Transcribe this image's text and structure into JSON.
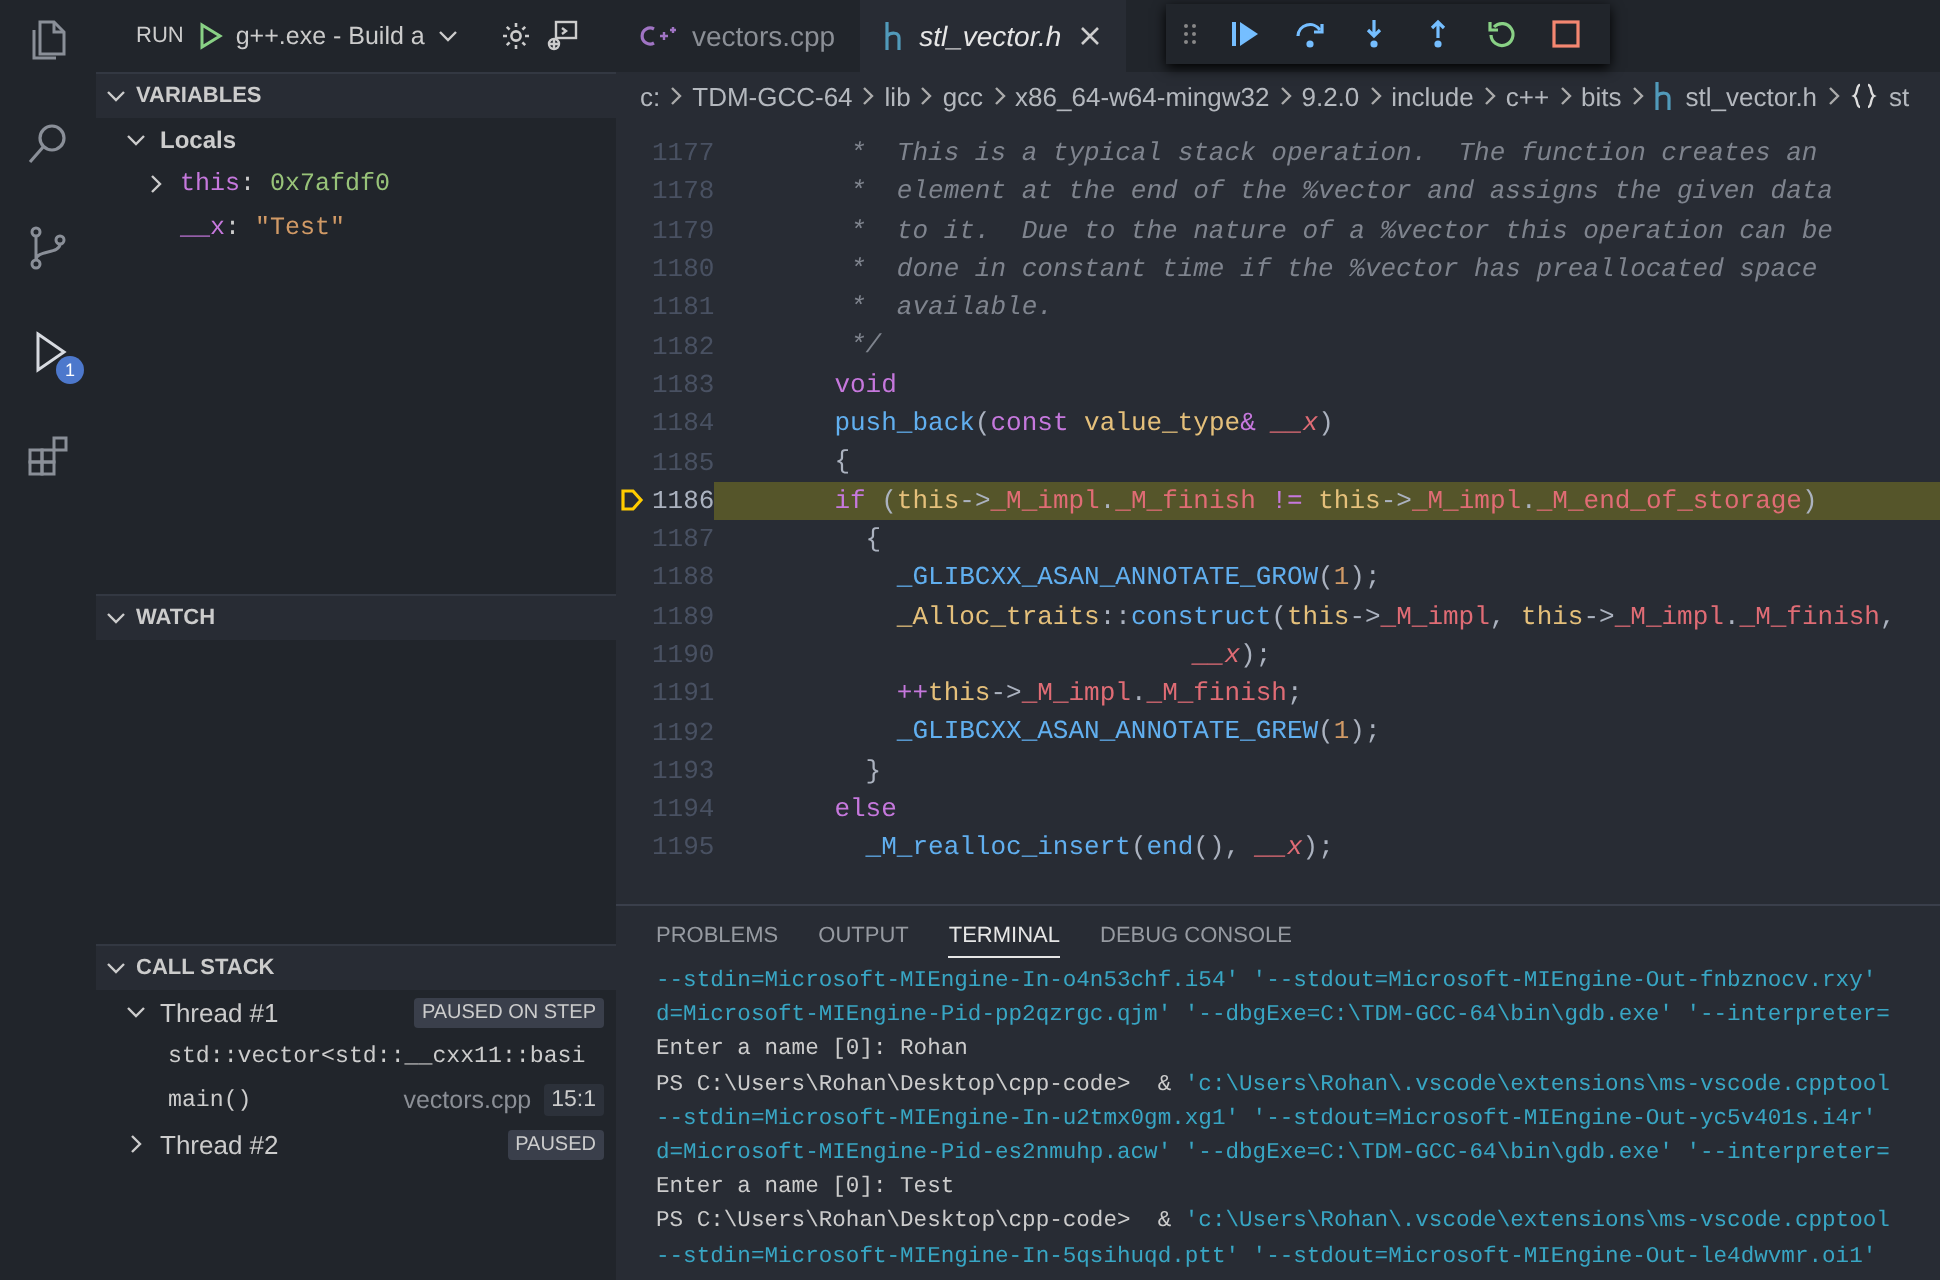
{
  "activity_bar": {
    "items": [
      {
        "kind": "files",
        "selected": false
      },
      {
        "kind": "search",
        "selected": false
      },
      {
        "kind": "source-control",
        "selected": false
      },
      {
        "kind": "debug",
        "selected": true,
        "badge": "1"
      },
      {
        "kind": "extensions",
        "selected": false
      }
    ]
  },
  "run_toolbar": {
    "label": "RUN",
    "configuration": "g++.exe - Build a"
  },
  "sidebar": {
    "variables": {
      "title": "VARIABLES",
      "scopes": [
        {
          "label": "Locals",
          "expanded": true,
          "children": [
            {
              "name": "this",
              "separator": ":",
              "value": "0x7afdf0",
              "expanded": false,
              "kind": "pointer"
            },
            {
              "name": "__x",
              "separator": ":",
              "value": "\"Test\"",
              "kind": "string"
            }
          ]
        }
      ]
    },
    "watch": {
      "title": "WATCH"
    },
    "call_stack": {
      "title": "CALL STACK",
      "threads": [
        {
          "label": "Thread #1",
          "expanded": true,
          "status": "PAUSED ON STEP",
          "frames": [
            {
              "name": "std::vector<std::__cxx11::basi"
            },
            {
              "name": "main()",
              "file": "vectors.cpp",
              "position": "15:1"
            }
          ]
        },
        {
          "label": "Thread #2",
          "expanded": false,
          "status": "PAUSED"
        }
      ]
    }
  },
  "tabs": [
    {
      "label": "vectors.cpp",
      "kind": "cpp",
      "selected": false
    },
    {
      "label": "stl_vector.h",
      "kind": "header",
      "selected": true
    }
  ],
  "debug_toolbar": [
    {
      "kind": "continue"
    },
    {
      "kind": "step-over"
    },
    {
      "kind": "step-into"
    },
    {
      "kind": "step-out"
    },
    {
      "kind": "restart"
    },
    {
      "kind": "stop"
    }
  ],
  "breadcrumb": [
    {
      "label": "c:"
    },
    {
      "label": "TDM-GCC-64"
    },
    {
      "label": "lib"
    },
    {
      "label": "gcc"
    },
    {
      "label": "x86_64-w64-mingw32"
    },
    {
      "label": "9.2.0"
    },
    {
      "label": "include"
    },
    {
      "label": "c++"
    },
    {
      "label": "bits"
    },
    {
      "label": "stl_vector.h",
      "kind": "header"
    },
    {
      "label": "st",
      "kind": "namespace"
    }
  ],
  "code": [
    {
      "number": "1177",
      "current": false,
      "tokens": [
        {
          "t": "     *  This is a typical stack operation.  The function creates an",
          "kind": "comment"
        }
      ]
    },
    {
      "number": "1178",
      "current": false,
      "tokens": [
        {
          "t": "     *  element at the end of the %vector and assigns the given data",
          "kind": "comment"
        }
      ]
    },
    {
      "number": "1179",
      "current": false,
      "tokens": [
        {
          "t": "     *  to it.  Due to the nature of a %vector this operation can be",
          "kind": "comment"
        }
      ]
    },
    {
      "number": "1180",
      "current": false,
      "tokens": [
        {
          "t": "     *  done in constant time if the %vector has preallocated space",
          "kind": "comment"
        }
      ]
    },
    {
      "number": "1181",
      "current": false,
      "tokens": [
        {
          "t": "     *  available.",
          "kind": "comment"
        }
      ]
    },
    {
      "number": "1182",
      "current": false,
      "tokens": [
        {
          "t": "     */",
          "kind": "comment"
        }
      ]
    },
    {
      "number": "1183",
      "current": false,
      "tokens": [
        {
          "t": "    void",
          "kind": "keyword"
        }
      ]
    },
    {
      "number": "1184",
      "current": false,
      "tokens": [
        {
          "t": "    push_back",
          "kind": "function"
        },
        {
          "t": "(",
          "kind": "plain"
        },
        {
          "t": "const",
          "kind": "keyword"
        },
        {
          "t": " value_type",
          "kind": "type"
        },
        {
          "t": "&",
          "kind": "keyword"
        },
        {
          "t": " __x",
          "kind": "param"
        },
        {
          "t": ")",
          "kind": "plain"
        }
      ]
    },
    {
      "number": "1185",
      "current": false,
      "tokens": [
        {
          "t": "    {",
          "kind": "plain"
        }
      ]
    },
    {
      "number": "1186",
      "current": true,
      "tokens": [
        {
          "t": "    if",
          "kind": "keyword"
        },
        {
          "t": " (",
          "kind": "plain"
        },
        {
          "t": "this",
          "kind": "type"
        },
        {
          "t": "->",
          "kind": "plain"
        },
        {
          "t": "_M_impl",
          "kind": "member"
        },
        {
          "t": ".",
          "kind": "plain"
        },
        {
          "t": "_M_finish",
          "kind": "member"
        },
        {
          "t": " != ",
          "kind": "keyword"
        },
        {
          "t": "this",
          "kind": "type"
        },
        {
          "t": "->",
          "kind": "plain"
        },
        {
          "t": "_M_impl",
          "kind": "member"
        },
        {
          "t": ".",
          "kind": "plain"
        },
        {
          "t": "_M_end_of_storage",
          "kind": "member"
        },
        {
          "t": ")",
          "kind": "plain"
        }
      ]
    },
    {
      "number": "1187",
      "current": false,
      "tokens": [
        {
          "t": "      {",
          "kind": "plain"
        }
      ]
    },
    {
      "number": "1188",
      "current": false,
      "tokens": [
        {
          "t": "        _GLIBCXX_ASAN_ANNOTATE_GROW",
          "kind": "function"
        },
        {
          "t": "(",
          "kind": "plain"
        },
        {
          "t": "1",
          "kind": "number"
        },
        {
          "t": ");",
          "kind": "plain"
        }
      ]
    },
    {
      "number": "1189",
      "current": false,
      "tokens": [
        {
          "t": "        _Alloc_traits",
          "kind": "type"
        },
        {
          "t": "::",
          "kind": "plain"
        },
        {
          "t": "construct",
          "kind": "function"
        },
        {
          "t": "(",
          "kind": "plain"
        },
        {
          "t": "this",
          "kind": "type"
        },
        {
          "t": "->",
          "kind": "plain"
        },
        {
          "t": "_M_impl",
          "kind": "member"
        },
        {
          "t": ", ",
          "kind": "plain"
        },
        {
          "t": "this",
          "kind": "type"
        },
        {
          "t": "->",
          "kind": "plain"
        },
        {
          "t": "_M_impl",
          "kind": "member"
        },
        {
          "t": ".",
          "kind": "plain"
        },
        {
          "t": "_M_finish",
          "kind": "member"
        },
        {
          "t": ",",
          "kind": "plain"
        }
      ]
    },
    {
      "number": "1190",
      "current": false,
      "tokens": [
        {
          "t": "                           __x",
          "kind": "param"
        },
        {
          "t": ");",
          "kind": "plain"
        }
      ]
    },
    {
      "number": "1191",
      "current": false,
      "tokens": [
        {
          "t": "        ++",
          "kind": "keyword"
        },
        {
          "t": "this",
          "kind": "type"
        },
        {
          "t": "->",
          "kind": "plain"
        },
        {
          "t": "_M_impl",
          "kind": "member"
        },
        {
          "t": ".",
          "kind": "plain"
        },
        {
          "t": "_M_finish",
          "kind": "member"
        },
        {
          "t": ";",
          "kind": "plain"
        }
      ]
    },
    {
      "number": "1192",
      "current": false,
      "tokens": [
        {
          "t": "        _GLIBCXX_ASAN_ANNOTATE_GREW",
          "kind": "function"
        },
        {
          "t": "(",
          "kind": "plain"
        },
        {
          "t": "1",
          "kind": "number"
        },
        {
          "t": ");",
          "kind": "plain"
        }
      ]
    },
    {
      "number": "1193",
      "current": false,
      "tokens": [
        {
          "t": "      }",
          "kind": "plain"
        }
      ]
    },
    {
      "number": "1194",
      "current": false,
      "tokens": [
        {
          "t": "    else",
          "kind": "keyword"
        }
      ]
    },
    {
      "number": "1195",
      "current": false,
      "tokens": [
        {
          "t": "      _M_realloc_insert",
          "kind": "function"
        },
        {
          "t": "(",
          "kind": "plain"
        },
        {
          "t": "end",
          "kind": "function"
        },
        {
          "t": "(), ",
          "kind": "plain"
        },
        {
          "t": "__x",
          "kind": "param"
        },
        {
          "t": ");",
          "kind": "plain"
        }
      ]
    }
  ],
  "panel": {
    "tabs": [
      {
        "label": "PROBLEMS",
        "selected": false
      },
      {
        "label": "OUTPUT",
        "selected": false
      },
      {
        "label": "TERMINAL",
        "selected": true
      },
      {
        "label": "DEBUG CONSOLE",
        "selected": false
      }
    ],
    "terminal": [
      [
        {
          "t": "--stdin=Microsoft-MIEngine-In-o4n53chf.i54' '--stdout=Microsoft-MIEngine-Out-fnbznocv.rxy'",
          "kind": "arg"
        }
      ],
      [
        {
          "t": "d=Microsoft-MIEngine-Pid-pp2qzrgc.qjm' '--dbgExe=C:\\TDM-GCC-64\\bin\\gdb.exe' '--interpreter=",
          "kind": "arg"
        }
      ],
      [
        {
          "t": "Enter a name [0]: Rohan",
          "kind": "plain"
        }
      ],
      [
        {
          "t": "PS C:\\Users\\Rohan\\Desktop\\cpp-code>  & ",
          "kind": "plain"
        },
        {
          "t": "'c:\\Users\\Rohan\\.vscode\\extensions\\ms-vscode.cpptool",
          "kind": "arg"
        }
      ],
      [
        {
          "t": "--stdin=Microsoft-MIEngine-In-u2tmx0gm.xg1' '--stdout=Microsoft-MIEngine-Out-yc5v401s.i4r'",
          "kind": "arg"
        }
      ],
      [
        {
          "t": "d=Microsoft-MIEngine-Pid-es2nmuhp.acw' '--dbgExe=C:\\TDM-GCC-64\\bin\\gdb.exe' '--interpreter=",
          "kind": "arg"
        }
      ],
      [
        {
          "t": "Enter a name [0]: Test",
          "kind": "plain"
        }
      ],
      [
        {
          "t": "PS C:\\Users\\Rohan\\Desktop\\cpp-code>  & ",
          "kind": "plain"
        },
        {
          "t": "'c:\\Users\\Rohan\\.vscode\\extensions\\ms-vscode.cpptool",
          "kind": "arg"
        }
      ],
      [
        {
          "t": "--stdin=Microsoft-MIEngine-In-5qsihuqd.ptt' '--stdout=Microsoft-MIEngine-Out-le4dwvmr.oi1'",
          "kind": "arg"
        }
      ]
    ]
  }
}
